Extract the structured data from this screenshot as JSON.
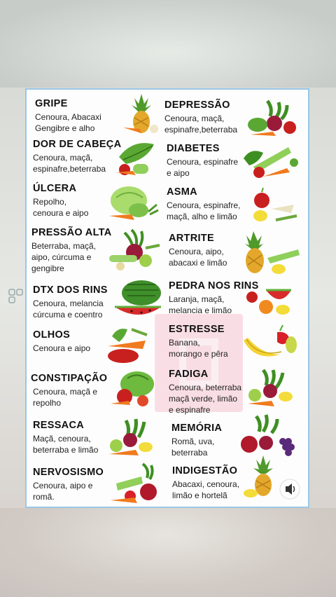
{
  "items": {
    "gripe": {
      "title": "GRIPE",
      "line1": "Cenoura, Abacaxi",
      "line2": "Gengibre e alho"
    },
    "depressao": {
      "title": "DEPRESSÃO",
      "line1": "Cenoura, maçã,",
      "line2": "espinafre,beterraba"
    },
    "dor_cabeca": {
      "title": "DOR DE CABEÇA",
      "line1": "Cenoura, maçã,",
      "line2": "espinafre,beterraba"
    },
    "diabetes": {
      "title": "DIABETES",
      "line1": "Cenoura, espinafre",
      "line2": "e aipo"
    },
    "ulcera": {
      "title": "ÚLCERA",
      "line1": "Repolho,",
      "line2": "cenoura e aipo"
    },
    "asma": {
      "title": "ASMA",
      "line1": "Cenoura, espinafre,",
      "line2": "maçã, alho e limão"
    },
    "pressao": {
      "title": "PRESSÃO ALTA",
      "line1": "Beterraba, maçã,",
      "line2": "aipo, cúrcuma e",
      "line3": "gengibre"
    },
    "artrite": {
      "title": "ARTRITE",
      "line1": "Cenoura, aipo,",
      "line2": "abacaxi e limão"
    },
    "dtx": {
      "title": "DTX DOS RINS",
      "line1": "Cenoura, melancia",
      "line2": "cúrcuma e coentro"
    },
    "pedra": {
      "title": "PEDRA NOS RINS",
      "line1": "Laranja, maçã,",
      "line2": "melancia e limão"
    },
    "olhos": {
      "title": "OLHOS",
      "line1": "Cenoura e aipo"
    },
    "estresse": {
      "title": "ESTRESSE",
      "line1": "Banana,",
      "line2": "morango e pêra"
    },
    "constipacao": {
      "title": "CONSTIPAÇÃO",
      "line1": "Cenoura, maçã e",
      "line2": "repolho"
    },
    "fadiga": {
      "title": "FADIGA",
      "line1": "Cenoura, beterraba",
      "line2": "maçã verde, limão",
      "line3": "e espinafre"
    },
    "ressaca": {
      "title": "RESSACA",
      "line1": "Maçã, cenoura,",
      "line2": "beterraba e limão"
    },
    "memoria": {
      "title": "MEMÓRIA",
      "line1": "Romã, uva,",
      "line2": "beterraba"
    },
    "nervosismo": {
      "title": "NERVOSISMO",
      "line1": "Cenoura, aipo e",
      "line2": "romã."
    },
    "indigestao": {
      "title": "INDIGESTÃO",
      "line1": "Abacaxi, cenoura,",
      "line2": "limão e hortelã"
    }
  },
  "colors": {
    "border": "#9ac7e6",
    "carrot": "#f07a1e",
    "green": "#4f9a2a",
    "red": "#c8201e"
  }
}
